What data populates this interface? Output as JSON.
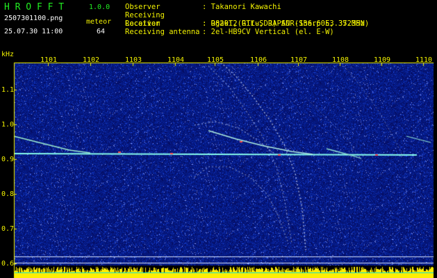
{
  "header": {
    "app_name": "H R O F F T",
    "version": "1.0.0",
    "filename": "2507301100.png",
    "meteor_label": "meteor",
    "datetime": "25.07.30 11:00",
    "meteor_count": "64",
    "info": [
      {
        "key": "Observer",
        "value": ": Takanori Kawachi"
      },
      {
        "key": "Receiving Location",
        "value": ": Ogaki, Gifu, JAPAN (136.60E, 35.35N)"
      },
      {
        "key": "Receiver",
        "value": ": R820T2(RTL-SDR) SDR-Sharp 53.372MHz"
      },
      {
        "key": "Receiving antenna",
        "value": ": 2el-HB9CV Vertical (el. E-W)"
      }
    ]
  },
  "plot": {
    "y_unit": "kHz",
    "x_ticks": [
      "1101",
      "1102",
      "1103",
      "1104",
      "1105",
      "1106",
      "1107",
      "1108",
      "1109",
      "1110"
    ],
    "y_ticks": [
      "1.1",
      "1.0",
      "0.9",
      "0.8",
      "0.7",
      "0.6"
    ],
    "colors": {
      "background_noise": "#0a1a8c",
      "carrier": "#88ffee",
      "trace": "#e0e8ff",
      "power_bar": "#ffee00",
      "label": "#f2f200",
      "title": "#22ee22"
    }
  }
}
